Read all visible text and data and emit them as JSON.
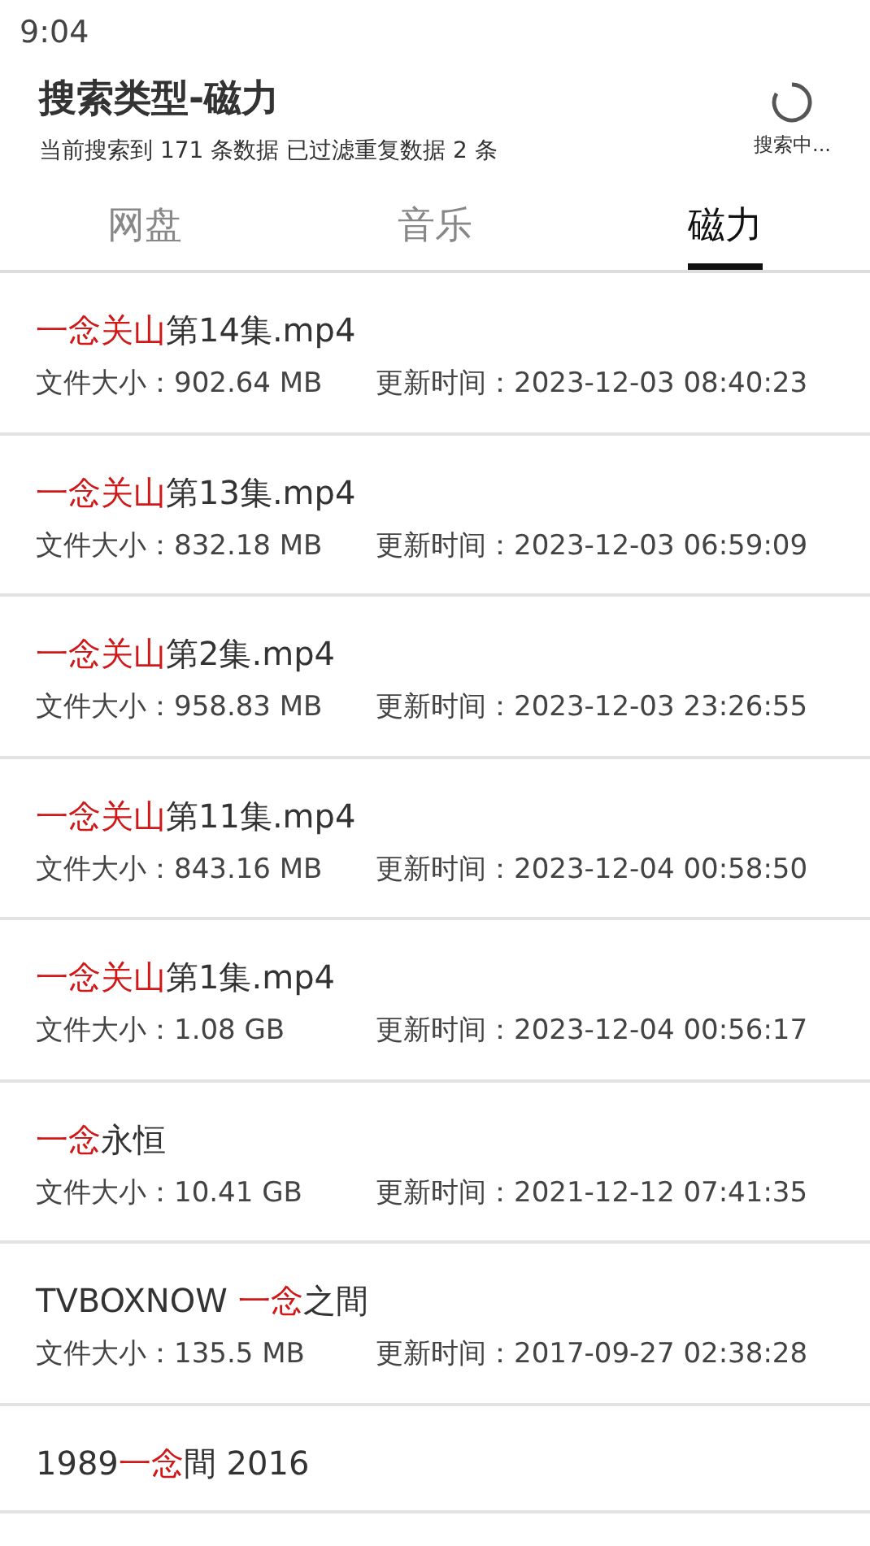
{
  "status_bar": {
    "time": "9:04"
  },
  "header": {
    "title": "搜索类型-磁力",
    "summary": "当前搜索到 171 条数据 已过滤重复数据 2 条",
    "status": "搜索中..."
  },
  "tabs": [
    {
      "label": "网盘",
      "selected": false
    },
    {
      "label": "音乐",
      "selected": false
    },
    {
      "label": "磁力",
      "selected": true
    }
  ],
  "results": [
    {
      "title": [
        {
          "kind": "match",
          "text": "一念关山"
        },
        {
          "kind": "plain",
          "text": "第14集.mp4"
        }
      ],
      "size": "文件大小：902.64 MB",
      "updated": "更新时间：2023-12-03 08:40:23"
    },
    {
      "title": [
        {
          "kind": "match",
          "text": "一念关山"
        },
        {
          "kind": "plain",
          "text": "第13集.mp4"
        }
      ],
      "size": "文件大小：832.18 MB",
      "updated": "更新时间：2023-12-03 06:59:09"
    },
    {
      "title": [
        {
          "kind": "match",
          "text": "一念关山"
        },
        {
          "kind": "plain",
          "text": "第2集.mp4"
        }
      ],
      "size": "文件大小：958.83 MB",
      "updated": "更新时间：2023-12-03 23:26:55"
    },
    {
      "title": [
        {
          "kind": "match",
          "text": "一念关山"
        },
        {
          "kind": "plain",
          "text": "第11集.mp4"
        }
      ],
      "size": "文件大小：843.16 MB",
      "updated": "更新时间：2023-12-04 00:58:50"
    },
    {
      "title": [
        {
          "kind": "match",
          "text": "一念关山"
        },
        {
          "kind": "plain",
          "text": "第1集.mp4"
        }
      ],
      "size": "文件大小：1.08 GB",
      "updated": "更新时间：2023-12-04 00:56:17"
    },
    {
      "title": [
        {
          "kind": "match",
          "text": "一念"
        },
        {
          "kind": "plain",
          "text": "永恒"
        }
      ],
      "size": "文件大小：10.41 GB",
      "updated": "更新时间：2021-12-12 07:41:35"
    },
    {
      "title": [
        {
          "kind": "plain",
          "text": "TVBOXNOW "
        },
        {
          "kind": "match",
          "text": "一念"
        },
        {
          "kind": "plain",
          "text": "之間"
        }
      ],
      "size": "文件大小：135.5 MB",
      "updated": "更新时间：2017-09-27 02:38:28"
    },
    {
      "title": [
        {
          "kind": "plain",
          "text": "1989"
        },
        {
          "kind": "match",
          "text": "一念"
        },
        {
          "kind": "plain",
          "text": "間 2016"
        }
      ]
    }
  ]
}
